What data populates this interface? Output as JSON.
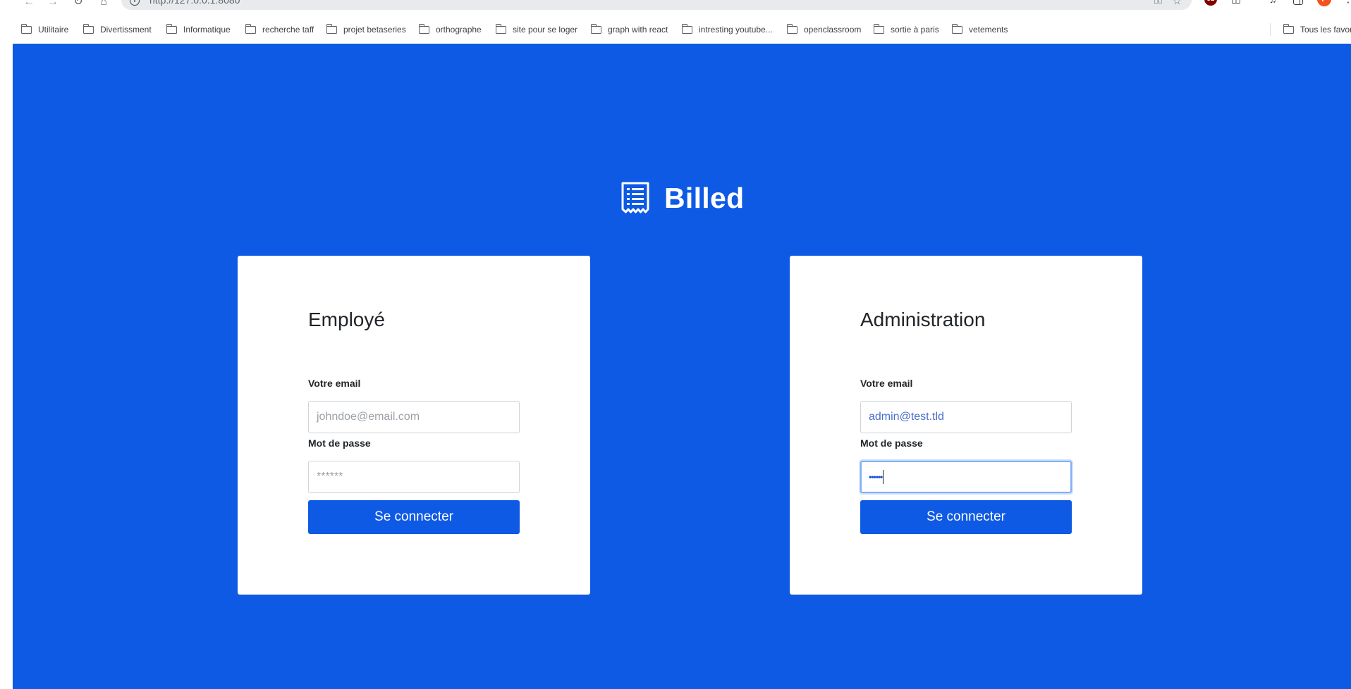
{
  "browser": {
    "url": "http://127.0.0.1:8080",
    "avatar_letter": "P",
    "ublock_label": "UB",
    "bookmarks": [
      "Utilitaire",
      "Divertissment",
      "Informatique",
      "recherche taff",
      "projet betaseries",
      "orthographe",
      "site pour se loger",
      "graph with react",
      "intresting youtube...",
      "openclassroom",
      "sortie à paris",
      "vetements"
    ],
    "all_bookmarks": "Tous les favoris",
    "icons": [
      "back-arrow-icon",
      "forward-arrow-icon",
      "reload-icon",
      "home-icon",
      "site-info-icon",
      "password-key-icon",
      "star-icon",
      "ublock-icon",
      "extensions-icon",
      "media-icon",
      "side-panel-icon",
      "menu-icon",
      "folder-icon"
    ]
  },
  "app": {
    "name": "Billed",
    "logo_icon": "receipt-icon",
    "brand_color": "#0e5ae5"
  },
  "employee": {
    "title": "Employé",
    "email_label": "Votre email",
    "email_placeholder": "johndoe@email.com",
    "email_value": "",
    "password_label": "Mot de passe",
    "password_placeholder": "******",
    "submit_label": "Se connecter"
  },
  "admin": {
    "title": "Administration",
    "email_label": "Votre email",
    "email_value": "admin@test.tld",
    "password_label": "Mot de passe",
    "password_value": "••••••",
    "submit_label": "Se connecter"
  }
}
